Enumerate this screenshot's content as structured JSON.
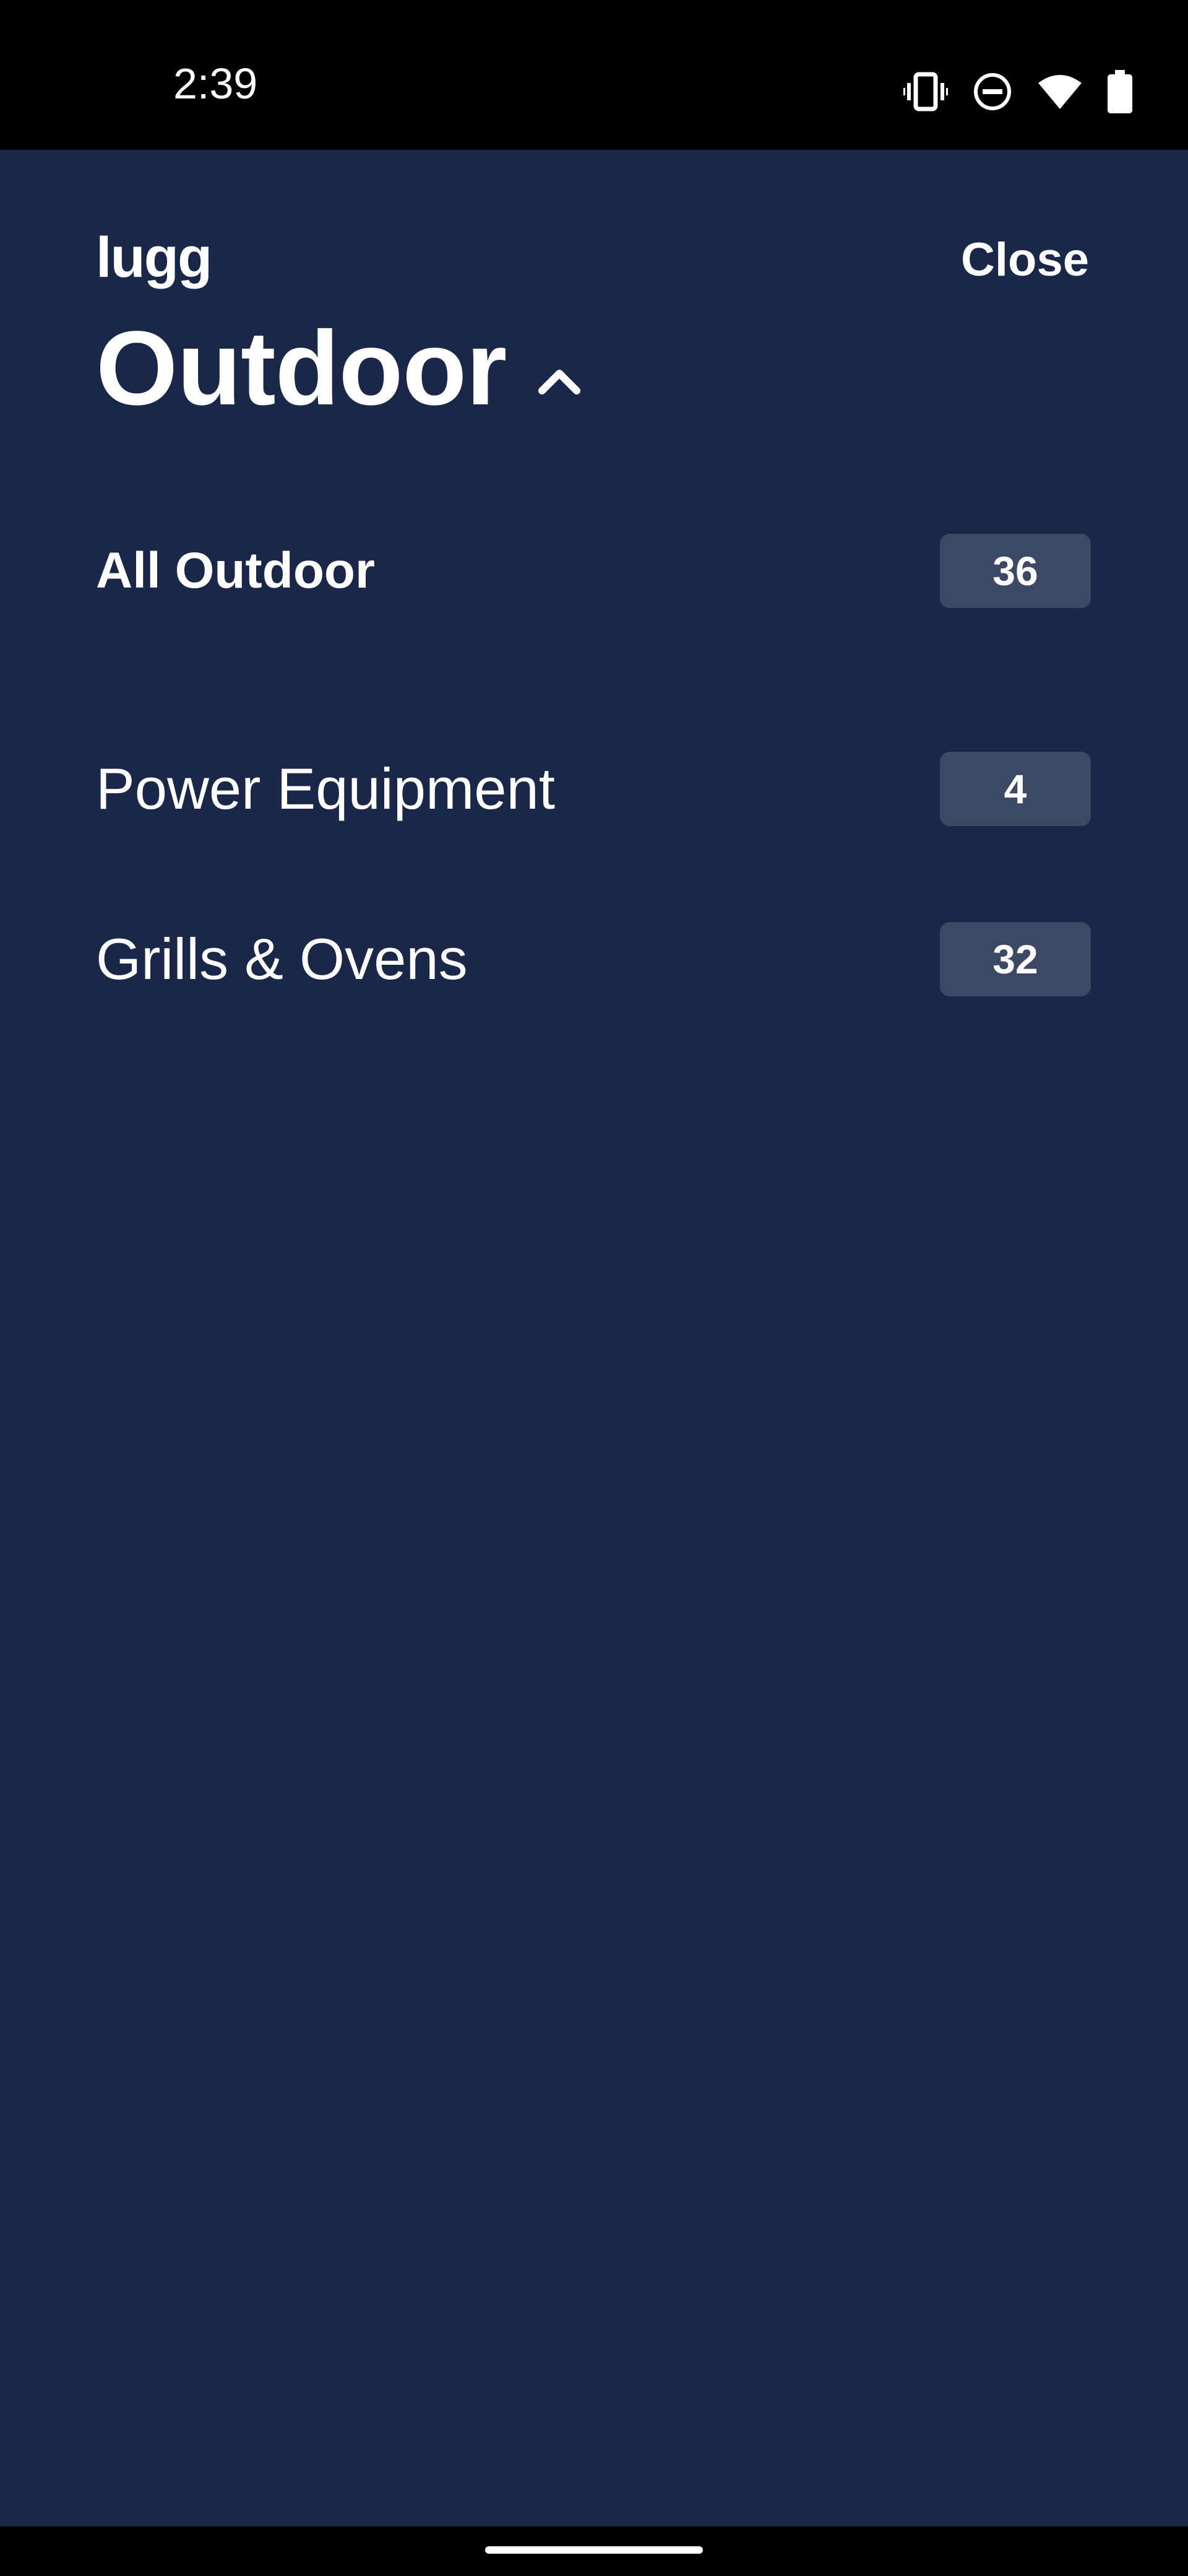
{
  "status_bar": {
    "time": "2:39",
    "icons": [
      "vibrate-icon",
      "do-not-disturb-icon",
      "wifi-icon",
      "battery-icon"
    ]
  },
  "header": {
    "logo": "lugg",
    "close_label": "Close"
  },
  "category": {
    "title": "Outdoor",
    "expanded": true
  },
  "items": [
    {
      "label": "All Outdoor",
      "count": "36",
      "bold": true
    },
    {
      "label": "Power Equipment",
      "count": "4",
      "bold": false
    },
    {
      "label": "Grills & Ovens",
      "count": "32",
      "bold": false
    }
  ],
  "colors": {
    "background": "#1b2749",
    "badge": "#3d4864",
    "text": "#ffffff",
    "system_bar": "#000000"
  }
}
